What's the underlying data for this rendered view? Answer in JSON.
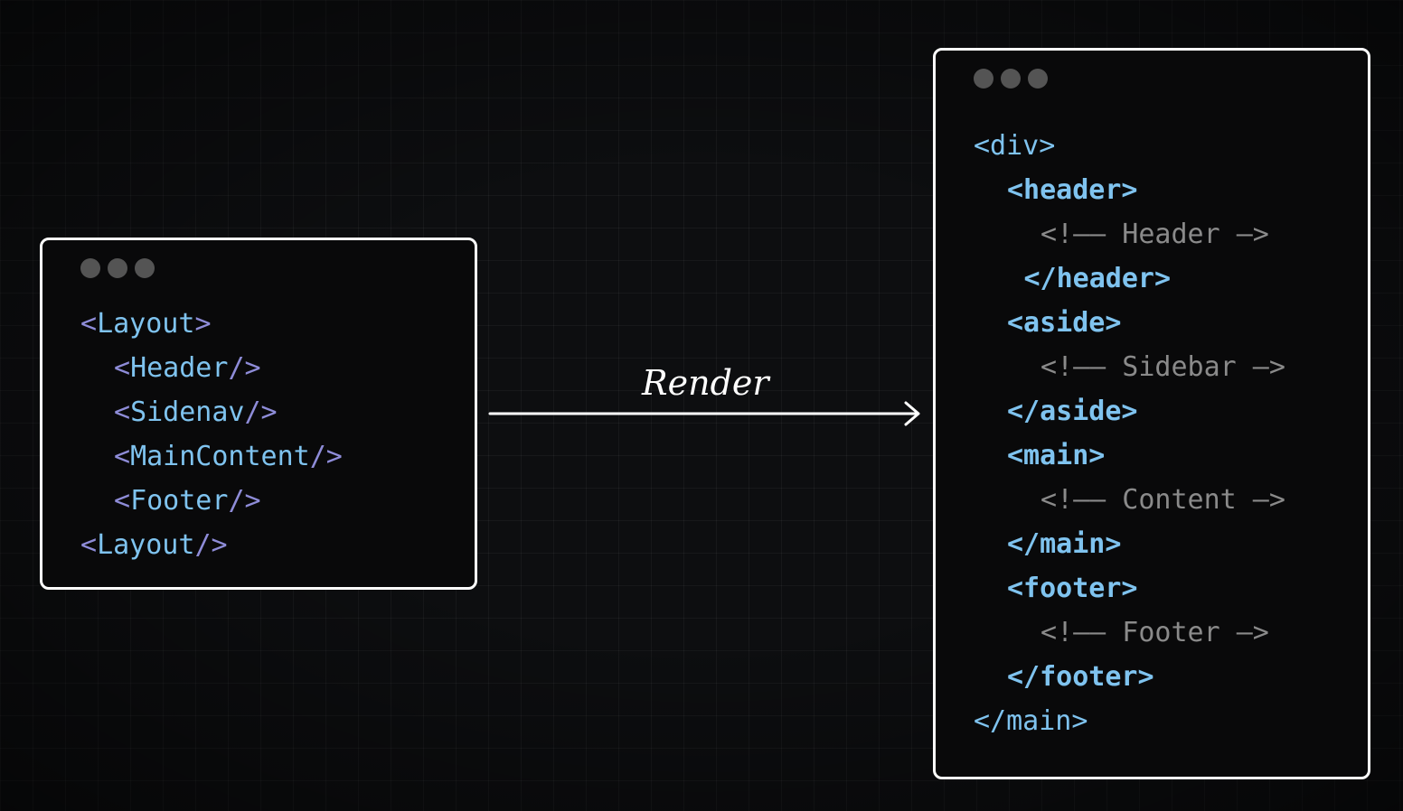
{
  "render_label": "Render",
  "left_window": {
    "lines": [
      {
        "indent": 0,
        "parts": [
          {
            "t": "<",
            "c": "punct"
          },
          {
            "t": "Layout",
            "c": "tag"
          },
          {
            "t": ">",
            "c": "punct"
          }
        ]
      },
      {
        "indent": 1,
        "parts": [
          {
            "t": "<",
            "c": "punct"
          },
          {
            "t": "Header",
            "c": "tag"
          },
          {
            "t": "/>",
            "c": "punct"
          }
        ]
      },
      {
        "indent": 1,
        "parts": [
          {
            "t": "<",
            "c": "punct"
          },
          {
            "t": "Sidenav",
            "c": "tag"
          },
          {
            "t": "/>",
            "c": "punct"
          }
        ]
      },
      {
        "indent": 1,
        "parts": [
          {
            "t": "<",
            "c": "punct"
          },
          {
            "t": "MainContent",
            "c": "tag"
          },
          {
            "t": "/>",
            "c": "punct"
          }
        ]
      },
      {
        "indent": 1,
        "parts": [
          {
            "t": "<",
            "c": "punct"
          },
          {
            "t": "Footer",
            "c": "tag"
          },
          {
            "t": "/>",
            "c": "punct"
          }
        ]
      },
      {
        "indent": 0,
        "parts": [
          {
            "t": "<",
            "c": "punct"
          },
          {
            "t": "Layout",
            "c": "tag"
          },
          {
            "t": "/>",
            "c": "punct"
          }
        ]
      }
    ]
  },
  "right_window": {
    "lines": [
      {
        "indent": 0,
        "parts": [
          {
            "t": "<div>",
            "c": "tag"
          }
        ]
      },
      {
        "indent": 1,
        "parts": [
          {
            "t": "<header>",
            "c": "tag-b"
          }
        ]
      },
      {
        "indent": 2,
        "parts": [
          {
            "t": "<!—— Header —>",
            "c": "comment"
          }
        ]
      },
      {
        "indent": 1.5,
        "parts": [
          {
            "t": "</header>",
            "c": "tag-b"
          }
        ]
      },
      {
        "indent": 1,
        "parts": [
          {
            "t": "<aside>",
            "c": "tag-b"
          }
        ]
      },
      {
        "indent": 2,
        "parts": [
          {
            "t": "<!—— Sidebar —>",
            "c": "comment"
          }
        ]
      },
      {
        "indent": 1,
        "parts": [
          {
            "t": "</aside>",
            "c": "tag-b"
          }
        ]
      },
      {
        "indent": 1,
        "parts": [
          {
            "t": "<main>",
            "c": "tag-b"
          }
        ]
      },
      {
        "indent": 2,
        "parts": [
          {
            "t": "<!—— Content —>",
            "c": "comment"
          }
        ]
      },
      {
        "indent": 1,
        "parts": [
          {
            "t": "</main>",
            "c": "tag-b"
          }
        ]
      },
      {
        "indent": 1,
        "parts": [
          {
            "t": "<footer>",
            "c": "tag-b"
          }
        ]
      },
      {
        "indent": 2,
        "parts": [
          {
            "t": "<!—— Footer —>",
            "c": "comment"
          }
        ]
      },
      {
        "indent": 1,
        "parts": [
          {
            "t": "</footer>",
            "c": "tag-b"
          }
        ]
      },
      {
        "indent": 0,
        "parts": [
          {
            "t": "</main>",
            "c": "tag"
          }
        ]
      }
    ]
  }
}
